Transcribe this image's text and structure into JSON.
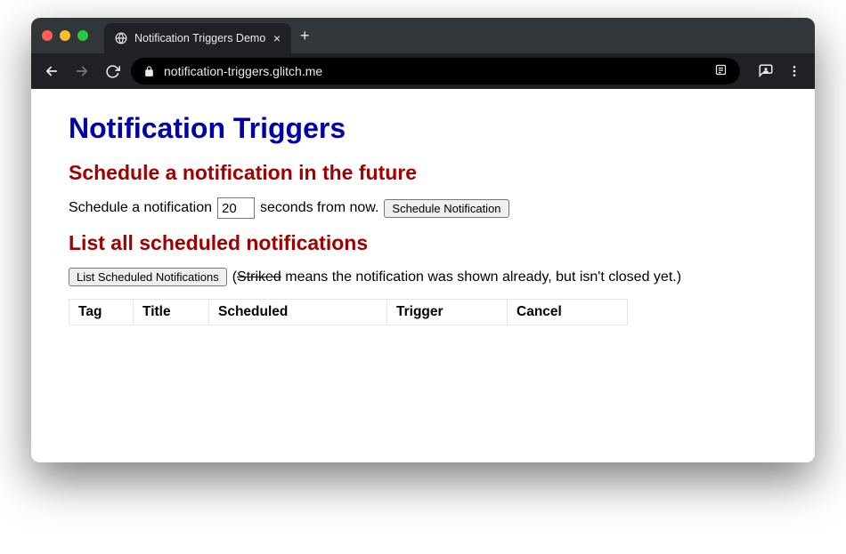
{
  "browser": {
    "tab_title": "Notification Triggers Demo",
    "url": "notification-triggers.glitch.me"
  },
  "page": {
    "title": "Notification Triggers",
    "section_schedule": {
      "heading": "Schedule a notification in the future",
      "prefix": "Schedule a notification",
      "seconds_value": "20",
      "suffix": "seconds from now.",
      "button": "Schedule Notification"
    },
    "section_list": {
      "heading": "List all scheduled notifications",
      "button": "List Scheduled Notifications",
      "note_open": "(",
      "note_striked": "Striked",
      "note_rest": " means the notification was shown already, but isn't closed yet.)",
      "columns": [
        "Tag",
        "Title",
        "Scheduled",
        "Trigger",
        "Cancel"
      ]
    }
  }
}
